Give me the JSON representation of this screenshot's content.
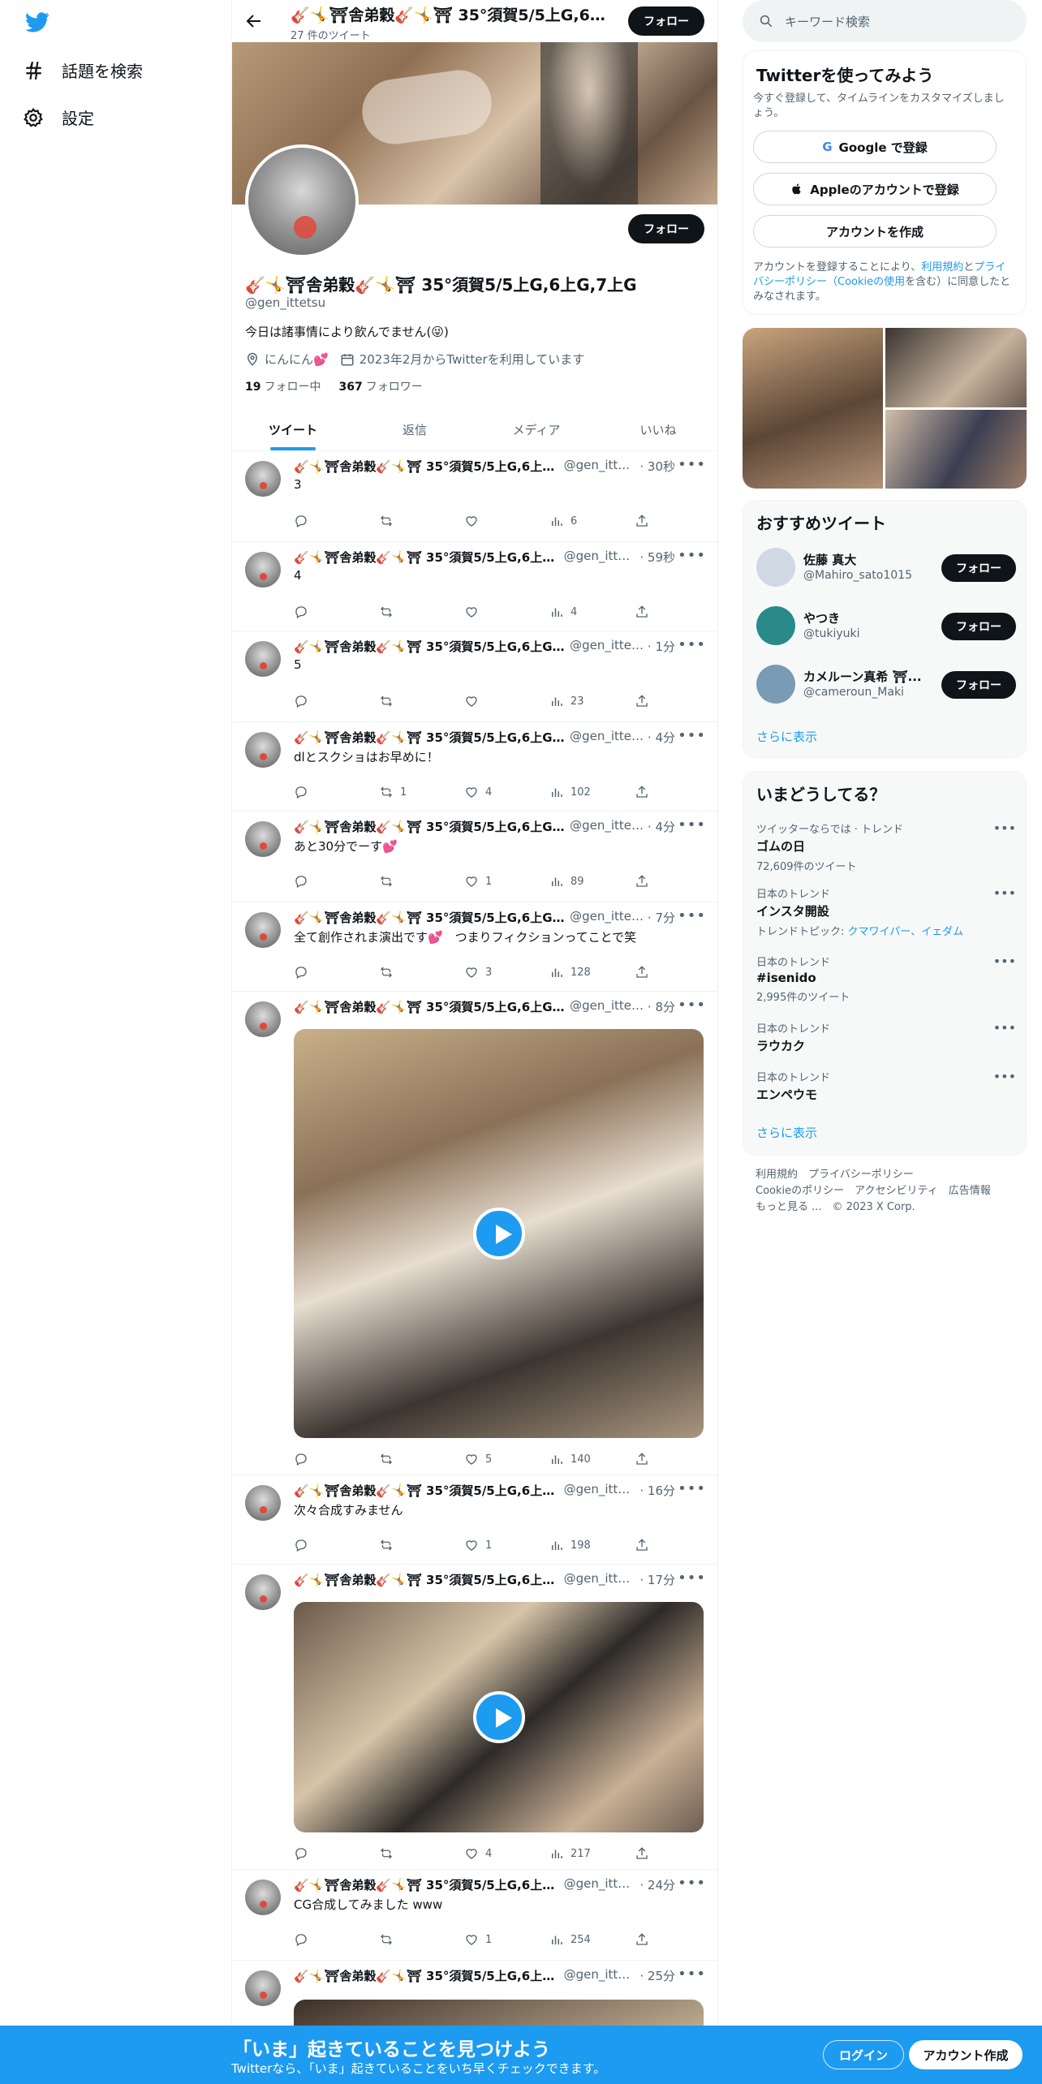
{
  "nav": {
    "explore_label": "話題を検索",
    "settings_label": "設定"
  },
  "header": {
    "name": "🎸🤸⛩舎弟穀🎸🤸⛩ 35°須賀5/5上G,6上G,7上G",
    "tweet_count": "27 件のツイート",
    "follow_label": "フォロー"
  },
  "profile": {
    "name": "🎸🤸⛩舎弟穀🎸🤸⛩ 35°須賀5/5上G,6上G,7上G",
    "handle": "@gen_ittetsu",
    "bio": "今日は諸事情により飲んでません(😜)",
    "location": "にんにん💕",
    "joined": "2023年2月からTwitterを利用しています",
    "following_count": "19",
    "following_label": "フォロー中",
    "followers_count": "367",
    "followers_label": "フォロワー",
    "follow_label": "フォロー"
  },
  "tabs": [
    "ツイート",
    "返信",
    "メディア",
    "いいね"
  ],
  "tweets": [
    {
      "name": "🎸🤸⛩舎弟穀🎸🤸⛩ 35°須賀5/5上G,6上G,7...",
      "handle": "@gen_ittet...",
      "time": "· 30秒",
      "text": "3",
      "retweets": "",
      "likes": "",
      "views": "6"
    },
    {
      "name": "🎸🤸⛩舎弟穀🎸🤸⛩ 35°須賀5/5上G,6上G,7...",
      "handle": "@gen_ittet...",
      "time": "· 59秒",
      "text": "4",
      "retweets": "",
      "likes": "",
      "views": "4"
    },
    {
      "name": "🎸🤸⛩舎弟穀🎸🤸⛩ 35°須賀5/5上G,6上G,7...",
      "handle": "@gen_ittet...",
      "time": "· 1分",
      "text": "5",
      "retweets": "",
      "likes": "",
      "views": "23"
    },
    {
      "name": "🎸🤸⛩舎弟穀🎸🤸⛩ 35°須賀5/5上G,6上G,7...",
      "handle": "@gen_ittet...",
      "time": "· 4分",
      "text": "dlとスクショはお早めに！",
      "retweets": "1",
      "likes": "4",
      "views": "102"
    },
    {
      "name": "🎸🤸⛩舎弟穀🎸🤸⛩ 35°須賀5/5上G,6上G,7...",
      "handle": "@gen_ittet...",
      "time": "· 4分",
      "text": "あと30分でーす💕",
      "retweets": "",
      "likes": "1",
      "views": "89"
    },
    {
      "name": "🎸🤸⛩舎弟穀🎸🤸⛩ 35°須賀5/5上G,6上G,7...",
      "handle": "@gen_ittet...",
      "time": "· 7分",
      "text": "全て創作されま演出です💕　つまりフィクションってことで笑",
      "retweets": "",
      "likes": "3",
      "views": "128"
    },
    {
      "name": "🎸🤸⛩舎弟穀🎸🤸⛩ 35°須賀5/5上G,6上G,7...",
      "handle": "@gen_ittet...",
      "time": "· 8分",
      "text": "",
      "retweets": "",
      "likes": "5",
      "views": "140"
    },
    {
      "name": "🎸🤸⛩舎弟穀🎸🤸⛩ 35°須賀5/5上G,6上G,7...",
      "handle": "@gen_ittet...",
      "time": "· 16分",
      "text": "次々合成すみません",
      "retweets": "",
      "likes": "1",
      "views": "198"
    },
    {
      "name": "🎸🤸⛩舎弟穀🎸🤸⛩ 35°須賀5/5上G,6上G,7...",
      "handle": "@gen_ittet...",
      "time": "· 17分",
      "text": "",
      "retweets": "",
      "likes": "4",
      "views": "217"
    },
    {
      "name": "🎸🤸⛩舎弟穀🎸🤸⛩ 35°須賀5/5上G,6上G,7...",
      "handle": "@gen_ittet...",
      "time": "· 24分",
      "text": "CG合成してみました www",
      "retweets": "",
      "likes": "1",
      "views": "254"
    },
    {
      "name": "🎸🤸⛩舎弟穀🎸🤸⛩ 35°須賀5/5上G,6上G,7...",
      "handle": "@gen_ittet...",
      "time": "· 25分",
      "text": "",
      "retweets": "",
      "likes": "",
      "views": ""
    }
  ],
  "search": {
    "placeholder": "キーワード検索"
  },
  "signup": {
    "title": "Twitterを使ってみよう",
    "subtitle": "今すぐ登録して、タイムラインをカスタマイズしましょう。",
    "google_label": "Google で登録",
    "apple_label": "Appleのアカウントで登録",
    "create_label": "アカウントを作成",
    "terms_prefix": "アカウントを登録することにより、",
    "terms_link": "利用規約",
    "terms_and": "と",
    "privacy_link": "プライバシーポリシー",
    "cookie_link": "（Cookieの使用",
    "terms_suffix": "を含む）に同意したとみなされます。"
  },
  "who_to_follow": {
    "title": "おすすめツイート",
    "users": [
      {
        "name": "佐藤 真大",
        "handle": "@Mahiro_sato1015",
        "color": "#cfd8e3"
      },
      {
        "name": "やつき",
        "handle": "@tukiyuki",
        "color": "#2a8a8a"
      },
      {
        "name": "カメルーン真希 ⛩...",
        "handle": "@cameroun_Maki",
        "color": "#7a9bb5"
      }
    ],
    "follow_label": "フォロー",
    "more_label": "さらに表示"
  },
  "trends": {
    "title": "いまどうしてる？",
    "items": [
      {
        "context": "ツイッターならでは · トレンド",
        "title": "ゴムの日",
        "count": "72,609件のツイート",
        "topics_label": "",
        "topics": ""
      },
      {
        "context": "日本のトレンド",
        "title": "インスタ開設",
        "count": "",
        "topics_label": "トレンドトピック: ",
        "topics": "クマワイパー、イェダム"
      },
      {
        "context": "日本のトレンド",
        "title": "#isenido",
        "count": "2,995件のツイート",
        "topics_label": "",
        "topics": ""
      },
      {
        "context": "日本のトレンド",
        "title": "ラウカク",
        "count": "",
        "topics_label": "",
        "topics": ""
      },
      {
        "context": "日本のトレンド",
        "title": "エンペウモ",
        "count": "",
        "topics_label": "",
        "topics": ""
      }
    ],
    "more_label": "さらに表示"
  },
  "footer": {
    "line1": "利用規約　プライバシーポリシー",
    "line2": "Cookieのポリシー　アクセシビリティ　広告情報",
    "line3": "もっと見る ...　© 2023 X Corp."
  },
  "bottom_bar": {
    "title": "「いま」起きていることを見つけよう",
    "subtitle": "Twitterなら、「いま」起きていることをいち早くチェックできます。",
    "login_label": "ログイン",
    "signup_label": "アカウント作成"
  },
  "colors": {
    "accent": "#1d9bf0",
    "text": "#0f1419",
    "muted": "#536471"
  }
}
